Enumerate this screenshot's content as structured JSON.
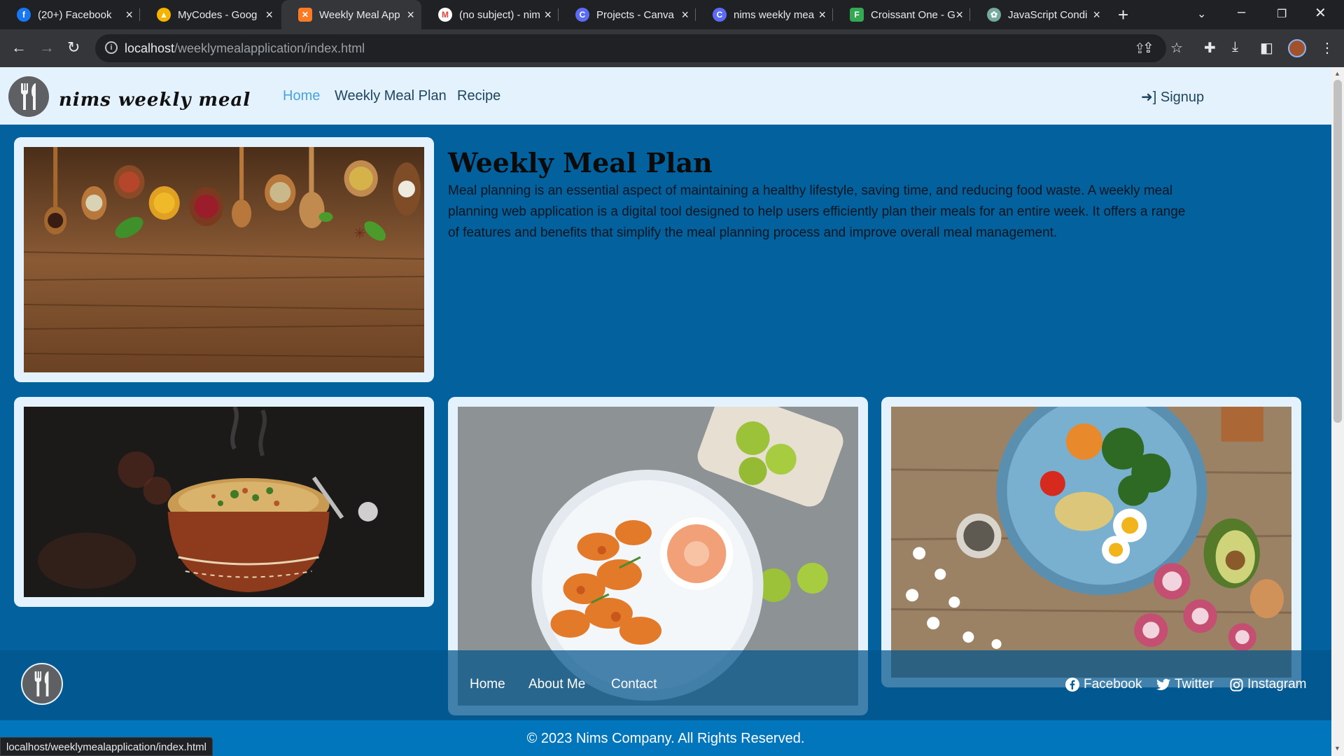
{
  "browser": {
    "tabs": [
      {
        "title": "(20+) Facebook",
        "icon": "facebook-icon",
        "color": "#1877f2",
        "glyph": "f"
      },
      {
        "title": "MyCodes - Goog",
        "icon": "google-drive-icon",
        "color": "#f4b400",
        "glyph": "▲"
      },
      {
        "title": "Weekly Meal App",
        "icon": "xampp-icon",
        "color": "#fb7a24",
        "glyph": "✕"
      },
      {
        "title": "(no subject) - nim",
        "icon": "gmail-icon",
        "color": "#ea4335",
        "glyph": "M"
      },
      {
        "title": "Projects - Canva",
        "icon": "canva-icon",
        "color": "#00c4cc",
        "glyph": "C"
      },
      {
        "title": "nims weekly mea",
        "icon": "canva-icon",
        "color": "#00c4cc",
        "glyph": "C"
      },
      {
        "title": "Croissant One - G",
        "icon": "google-fonts-icon",
        "color": "#4285f4",
        "glyph": "F"
      },
      {
        "title": "JavaScript Condi",
        "icon": "chatgpt-icon",
        "color": "#74aa9c",
        "glyph": "✿"
      }
    ],
    "url_host": "localhost",
    "url_path": "/weeklymealapplication/index.html",
    "status_url": "localhost/weeklymealapplication/index.html"
  },
  "header": {
    "brand": "nims weekly meal",
    "nav": [
      "Home",
      "Weekly Meal Plan",
      "Recipe"
    ],
    "signup": "Signup"
  },
  "intro": {
    "title": "Weekly Meal Plan",
    "text": "Meal planning is an essential aspect of maintaining a healthy lifestyle, saving time, and reducing food waste. A weekly meal planning web application is a digital tool designed to help users efficiently plan their meals for an entire week. It offers a range of features and benefits that simplify the meal planning process and improve overall meal management."
  },
  "images": [
    {
      "name": "spices-image",
      "subject": "spices on wooden spoons"
    },
    {
      "name": "biryani-image",
      "subject": "biryani in clay pot"
    },
    {
      "name": "shrimp-image",
      "subject": "fried shrimp with dip"
    },
    {
      "name": "salad-bowl-image",
      "subject": "salad bowl with egg"
    }
  ],
  "footer": {
    "links": [
      "Home",
      "About Me",
      "Contact"
    ],
    "social": [
      "Facebook",
      "Twitter",
      "Instagram"
    ],
    "copyright": "© 2023 Nims Company. All Rights Reserved."
  },
  "colors": {
    "page_bg": "#03619e",
    "header_bg": "#e3f2fd",
    "nav_active": "#4aa3df",
    "copyright_bg": "#0276bd"
  }
}
